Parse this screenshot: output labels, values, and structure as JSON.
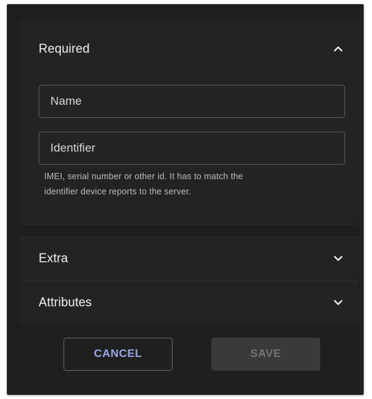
{
  "sections": {
    "required": {
      "title": "Required",
      "name_field": {
        "label": "Name"
      },
      "identifier_field": {
        "label": "Identifier",
        "helper_line1": "IMEI, serial number or other id. It has to match the",
        "helper_line2": "identifier device reports to the server."
      },
      "expanded": true
    },
    "extra": {
      "title": "Extra",
      "expanded": false
    },
    "attributes": {
      "title": "Attributes",
      "expanded": false
    }
  },
  "actions": {
    "cancel_label": "CANCEL",
    "save_label": "SAVE",
    "save_enabled": false
  },
  "colors": {
    "background": "#1f1f1f",
    "panel": "#232323",
    "accent": "#9aa6e8"
  },
  "icons": {
    "collapse": "chevron-up-icon",
    "expand": "chevron-down-icon"
  }
}
